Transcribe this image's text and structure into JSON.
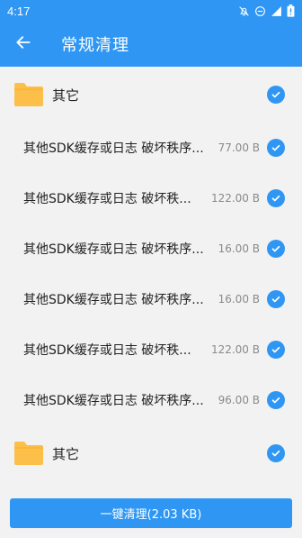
{
  "status_bar": {
    "time": "4:17",
    "icons": [
      "bell-off-icon",
      "do-not-disturb-icon",
      "signal-icon",
      "battery-icon"
    ]
  },
  "app_bar": {
    "back_icon": "arrow-left-icon",
    "title": "常规清理"
  },
  "groups": [
    {
      "label": "其它",
      "checked": true,
      "items": [
        {
          "title": "其他SDK缓存或日志 破坏秩序...",
          "size": "77.00 B",
          "checked": true
        },
        {
          "title": "其他SDK缓存或日志 破坏秩...",
          "size": "122.00 B",
          "checked": true
        },
        {
          "title": "其他SDK缓存或日志 破坏秩序...",
          "size": "16.00 B",
          "checked": true
        },
        {
          "title": "其他SDK缓存或日志 破坏秩序...",
          "size": "16.00 B",
          "checked": true
        },
        {
          "title": "其他SDK缓存或日志 破坏秩...",
          "size": "122.00 B",
          "checked": true
        },
        {
          "title": "其他SDK缓存或日志 破坏秩序...",
          "size": "96.00 B",
          "checked": true
        }
      ]
    },
    {
      "label": "其它",
      "checked": true,
      "items": []
    }
  ],
  "clean_button": {
    "label": "一键清理(2.03 KB)"
  },
  "colors": {
    "accent": "#2f97f3",
    "folder": "#fcbf49",
    "background": "#f2f2f2"
  }
}
